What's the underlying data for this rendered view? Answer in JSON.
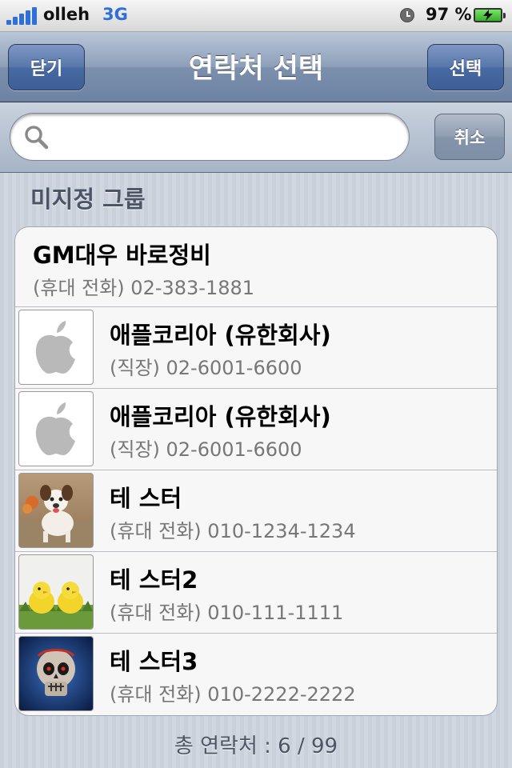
{
  "status_bar": {
    "carrier": "olleh",
    "network": "3G",
    "battery_percent": "97 %",
    "signal_bars": 5
  },
  "nav": {
    "close_label": "닫기",
    "title": "연락처 선택",
    "select_label": "선택"
  },
  "search": {
    "value": "",
    "placeholder": "",
    "cancel_label": "취소"
  },
  "group": {
    "title": "미지정 그룹"
  },
  "contacts": [
    {
      "name": "GM대우 바로정비",
      "detail": "(휴대 전화) 02-383-1881",
      "avatar": "none"
    },
    {
      "name": "애플코리아 (유한회사)",
      "detail": "(직장) 02-6001-6600",
      "avatar": "apple-logo"
    },
    {
      "name": "애플코리아 (유한회사)",
      "detail": "(직장) 02-6001-6600",
      "avatar": "apple-logo"
    },
    {
      "name": "테 스터",
      "detail": "(휴대 전화) 010-1234-1234",
      "avatar": "dog-photo"
    },
    {
      "name": "테 스터2",
      "detail": "(휴대 전화) 010-111-1111",
      "avatar": "chicks-photo"
    },
    {
      "name": "테 스터3",
      "detail": "(휴대 전화) 010-2222-2222",
      "avatar": "skull-photo"
    }
  ],
  "footer": {
    "total_text": "총 연락처 : 6 / 99"
  },
  "colors": {
    "nav_blue": "#5776ab",
    "network_blue": "#2f6fd8",
    "battery_green": "#36b12a"
  },
  "icons": [
    "signal-icon",
    "clock-icon",
    "battery-icon",
    "search-icon"
  ]
}
